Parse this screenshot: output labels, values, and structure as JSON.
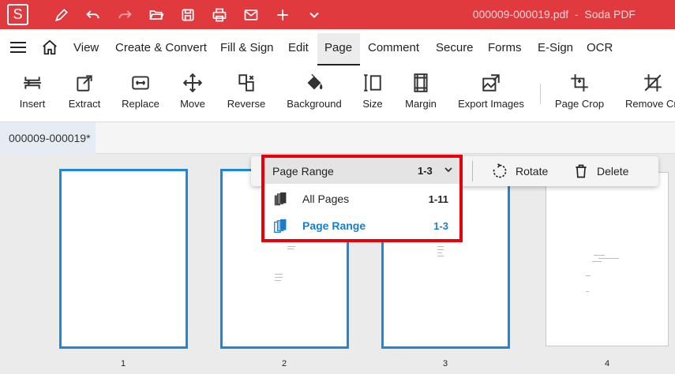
{
  "app": {
    "title": "000009-000019.pdf  -  Soda PDF",
    "logo_letter": "S",
    "quick_access": [
      "pen-icon",
      "undo-icon",
      "redo-icon",
      "open-folder-icon",
      "save-icon",
      "print-icon",
      "mail-icon",
      "add-icon",
      "chevron-down-icon"
    ]
  },
  "menu": {
    "items": [
      "View",
      "Create & Convert",
      "Fill & Sign",
      "Edit",
      "Page",
      "Comment",
      "Secure",
      "Forms",
      "E-Sign",
      "OCR"
    ],
    "active": "Page"
  },
  "ribbon": {
    "tools": [
      {
        "label": "Insert",
        "icon": "insert-icon"
      },
      {
        "label": "Extract",
        "icon": "extract-icon"
      },
      {
        "label": "Replace",
        "icon": "replace-icon"
      },
      {
        "label": "Move",
        "icon": "move-icon"
      },
      {
        "label": "Reverse",
        "icon": "reverse-icon"
      },
      {
        "label": "Background",
        "icon": "paint-bucket-icon"
      },
      {
        "label": "Size",
        "icon": "size-icon"
      },
      {
        "label": "Margin",
        "icon": "margin-icon"
      },
      {
        "label": "Export Images",
        "icon": "export-images-icon"
      },
      {
        "label": "Page Crop",
        "icon": "crop-icon"
      },
      {
        "label": "Remove Cr",
        "icon": "remove-crop-icon"
      }
    ]
  },
  "document_tab": {
    "label": "000009-000019*"
  },
  "pages": {
    "numbers": [
      "1",
      "2",
      "3",
      "4"
    ],
    "selected": [
      "1",
      "2",
      "3"
    ]
  },
  "floatbar": {
    "range_label": "Page Range",
    "range_value": "1-3",
    "rotate_label": "Rotate",
    "delete_label": "Delete"
  },
  "range_menu": {
    "options": [
      {
        "name": "All Pages",
        "value": "1-11",
        "selected": false
      },
      {
        "name": "Page Range",
        "value": "1-3",
        "selected": true
      }
    ]
  },
  "colors": {
    "brand": "#e0393e",
    "selection": "#1e88d8",
    "highlight": "#e8000b"
  }
}
